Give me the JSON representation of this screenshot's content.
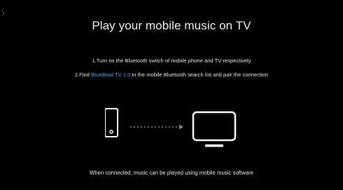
{
  "title": "Play your mobile music on TV",
  "steps": {
    "step1": "1.Turn on the Bluetooth switch of mobile phone and TV respectively",
    "step2_prefix": "2.Find ",
    "step2_device": "Bluedroid TV 1.0",
    "step2_suffix": " in the mobile Bluetooth search list and pair the connection"
  },
  "footer": "When connected, music can be played using mobile music software",
  "icons": {
    "phone": "mobile-phone-icon",
    "arrow": "dotted-arrow-icon",
    "tv": "tv-icon"
  },
  "colors": {
    "background": "#000000",
    "text": "#e6e6e6",
    "accent": "#3fa9e0",
    "arrow": "#888888"
  }
}
